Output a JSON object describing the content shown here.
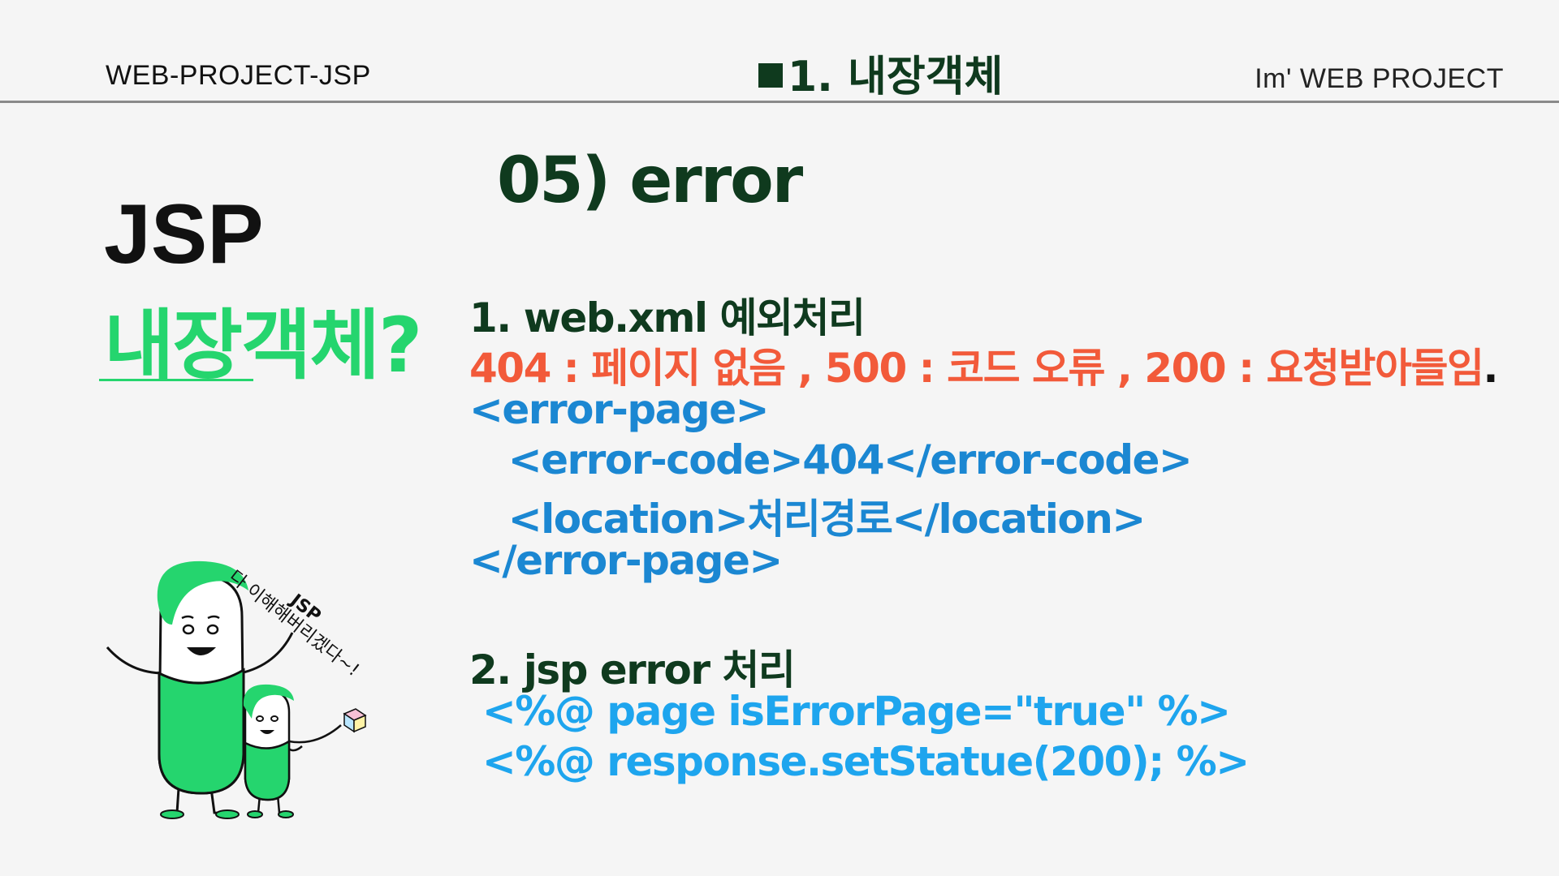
{
  "header": {
    "left": "WEB-PROJECT-JSP",
    "center": "1. 내장객체",
    "right": "Im'  WEB PROJECT"
  },
  "left": {
    "title": "JSP",
    "subtitle": "내장객체?"
  },
  "section": {
    "title": "05) error"
  },
  "content": {
    "heading1": "1. web.xml 예외처리",
    "codes_line": "404 : 페이지 없음 , 500 : 코드 오류 , 200 : 요청받아들임",
    "codes_period": ".",
    "xml": [
      "<error-page>",
      "   <error-code>404</error-code>",
      "   <location>처리경로</location>",
      "</error-page>"
    ],
    "heading2": "2. jsp error 처리",
    "jsp": [
      " <%@ page isErrorPage=\"true\" %>",
      " <%@ response.setStatue(200); %>"
    ]
  },
  "illustration": {
    "speech_line1": "JSP",
    "speech_line2": "다 이해해버리겠다~!"
  },
  "colors": {
    "accent_green": "#25d56e",
    "dark_green": "#0f3a1e",
    "red": "#f25a3a",
    "blue": "#1b87d2",
    "light_blue": "#1ea5ee"
  }
}
